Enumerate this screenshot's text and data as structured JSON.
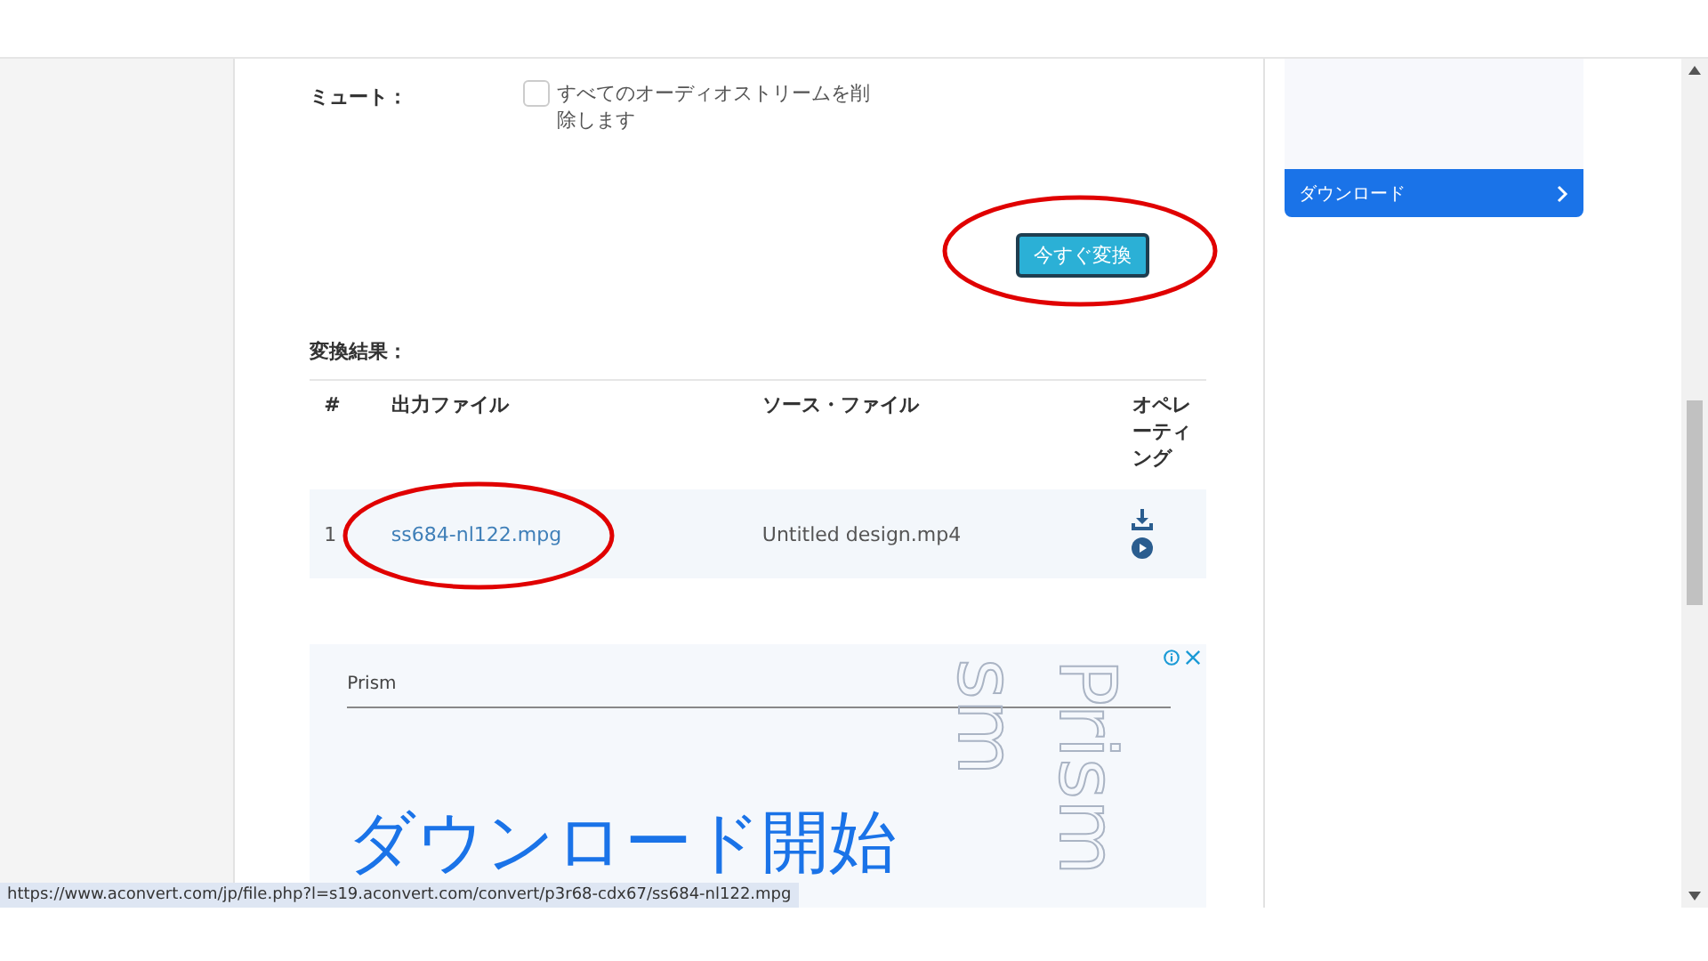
{
  "mute": {
    "label": "ミュート：",
    "checked": false,
    "text": "すべてのオーディオストリームを削除します"
  },
  "convert_button": {
    "label": "今すぐ変換",
    "circled": true
  },
  "results": {
    "title": "変換結果：",
    "columns": [
      "#",
      "出力ファイル",
      "ソース・ファイル",
      "オペレーティング"
    ],
    "rows": [
      {
        "index": "1",
        "output": "ss684-nl122.mpg",
        "output_circled": true,
        "source": "Untitled design.mp4"
      }
    ]
  },
  "ad": {
    "brand": "Prism",
    "headline": "ダウンロード開始",
    "art_texts": [
      "sm",
      "Prism"
    ]
  },
  "sidebar": {
    "button": "ダウンロード"
  },
  "status_url": "https://www.aconvert.com/jp/file.php?l=s19.aconvert.com/convert/p3r68-cdx67/ss684-nl122.mpg"
}
